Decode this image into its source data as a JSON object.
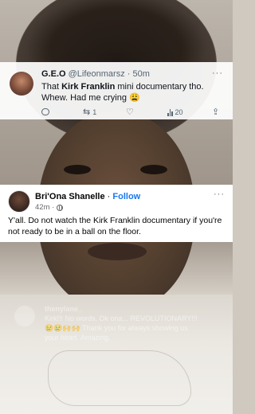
{
  "tweet": {
    "name": "G.E.O",
    "handle": "@Lifeonmarsz",
    "time": "· 50m",
    "more": "···",
    "text_before": "That ",
    "text_bold": "Kirk Franklin",
    "text_after": " mini documentary tho. Whew. Had me crying 😩",
    "retweets": "1",
    "views": "20",
    "icons": [
      "reply-icon",
      "retweet-icon",
      "like-icon",
      "views-icon",
      "share-icon"
    ]
  },
  "fb_post": {
    "name": "Bri'Ona Shanelle",
    "separator": "·",
    "follow": "Follow",
    "time": "42m ·",
    "more": "···",
    "text": "Y'all. Do not watch the Kirk Franklin documentary if you're not ready to be in a ball on the floor."
  },
  "overlay_comment": {
    "username": "thenylane_",
    "line1": "Kirk!!! No words. Ok ona... REVOLUTIONARY!!!",
    "line2": "😢😢🙌🙌 Thank you for always showing us",
    "line3": "your heart. Amazing."
  },
  "colors": {
    "twitter_text": "#0f1419",
    "twitter_muted": "#536471",
    "facebook_blue": "#1877f2",
    "facebook_muted": "#65676b"
  }
}
